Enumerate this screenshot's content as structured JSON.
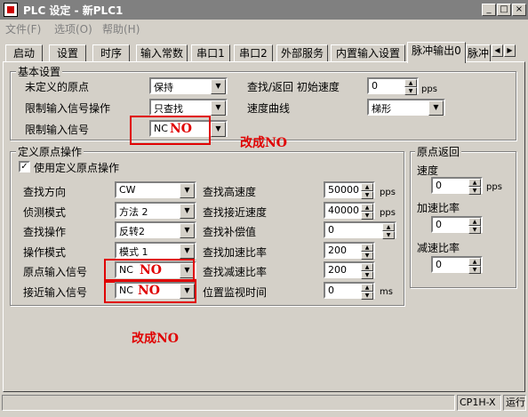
{
  "window": {
    "title": "PLC 设定 - 新PLC1",
    "controls": {
      "minimize": "_",
      "maximize": "□",
      "close": "×"
    }
  },
  "menu": {
    "items": [
      "文件(F)",
      "选项(O)",
      "帮助(H)"
    ]
  },
  "tabs": {
    "items": [
      "启动",
      "设置",
      "时序",
      "输入常数",
      "串口1",
      "串口2",
      "外部服务",
      "内置输入设置",
      "脉冲输出0",
      "脉冲"
    ],
    "active": "脉冲输出0"
  },
  "basic": {
    "group_label": "基本设置",
    "undefined_origin_label": "未定义的原点",
    "undefined_origin_value": "保持",
    "limit_op_label": "限制输入信号操作",
    "limit_op_value": "只查找",
    "limit_sig_label": "限制输入信号",
    "limit_sig_value": "NC",
    "search_speed_label": "查找/返回 初始速度",
    "search_speed_value": "0",
    "search_speed_unit": "pps",
    "curve_label": "速度曲线",
    "curve_value": "梯形"
  },
  "origin_def": {
    "group_label": "定义原点操作",
    "use_label": "使用定义原点操作",
    "use_checked": true,
    "direction_label": "查找方向",
    "direction_value": "CW",
    "detect_label": "侦测模式",
    "detect_value": "方法 2",
    "search_op_label": "查找操作",
    "search_op_value": "反转2",
    "op_mode_label": "操作模式",
    "op_mode_value": "模式 1",
    "origin_sig_label": "原点输入信号",
    "origin_sig_value": "NC",
    "near_sig_label": "接近输入信号",
    "near_sig_value": "NC",
    "high_speed_label": "查找高速度",
    "high_speed_value": "50000",
    "high_speed_unit": "pps",
    "near_speed_label": "查找接近速度",
    "near_speed_value": "40000",
    "near_speed_unit": "pps",
    "comp_label": "查找补偿值",
    "comp_value": "0",
    "accel_label": "查找加速比率",
    "accel_value": "200",
    "decel_label": "查找减速比率",
    "decel_value": "200",
    "monitor_label": "位置监视时间",
    "monitor_value": "0",
    "monitor_unit": "ms"
  },
  "origin_return": {
    "group_label": "原点返回",
    "speed_label": "速度",
    "speed_value": "0",
    "speed_unit": "pps",
    "accel_label": "加速比率",
    "accel_value": "0",
    "decel_label": "减速比率",
    "decel_value": "0"
  },
  "annotations": {
    "no_overlay": "NO",
    "note_change": "改成NO"
  },
  "status": {
    "model": "CP1H-X",
    "mode": "运行"
  }
}
